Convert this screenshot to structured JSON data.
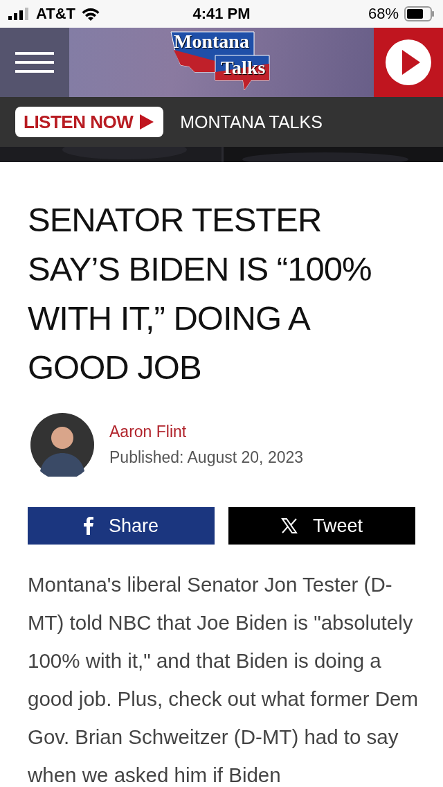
{
  "status_bar": {
    "carrier": "AT&T",
    "time": "4:41 PM",
    "battery": "68%"
  },
  "header": {
    "logo_top": "Montana",
    "logo_bottom": "Talks"
  },
  "listen_bar": {
    "button": "LISTEN NOW",
    "station": "MONTANA TALKS"
  },
  "article": {
    "headline": "SENATOR TESTER SAY’S BIDEN IS “100% WITH IT,” DOING A GOOD JOB",
    "author": "Aaron Flint",
    "published": "Published: August 20, 2023",
    "share_buttons": [
      {
        "kind": "facebook",
        "label": "Share"
      },
      {
        "kind": "x",
        "label": "Tweet"
      }
    ],
    "body": "Montana's liberal Senator Jon Tester (D-MT) told NBC that Joe Biden is \"absolutely 100% with it,\" and that Biden is doing a good job. Plus, check out what former Dem Gov. Brian Schweitzer (D-MT) had to say when we asked him if Biden"
  }
}
